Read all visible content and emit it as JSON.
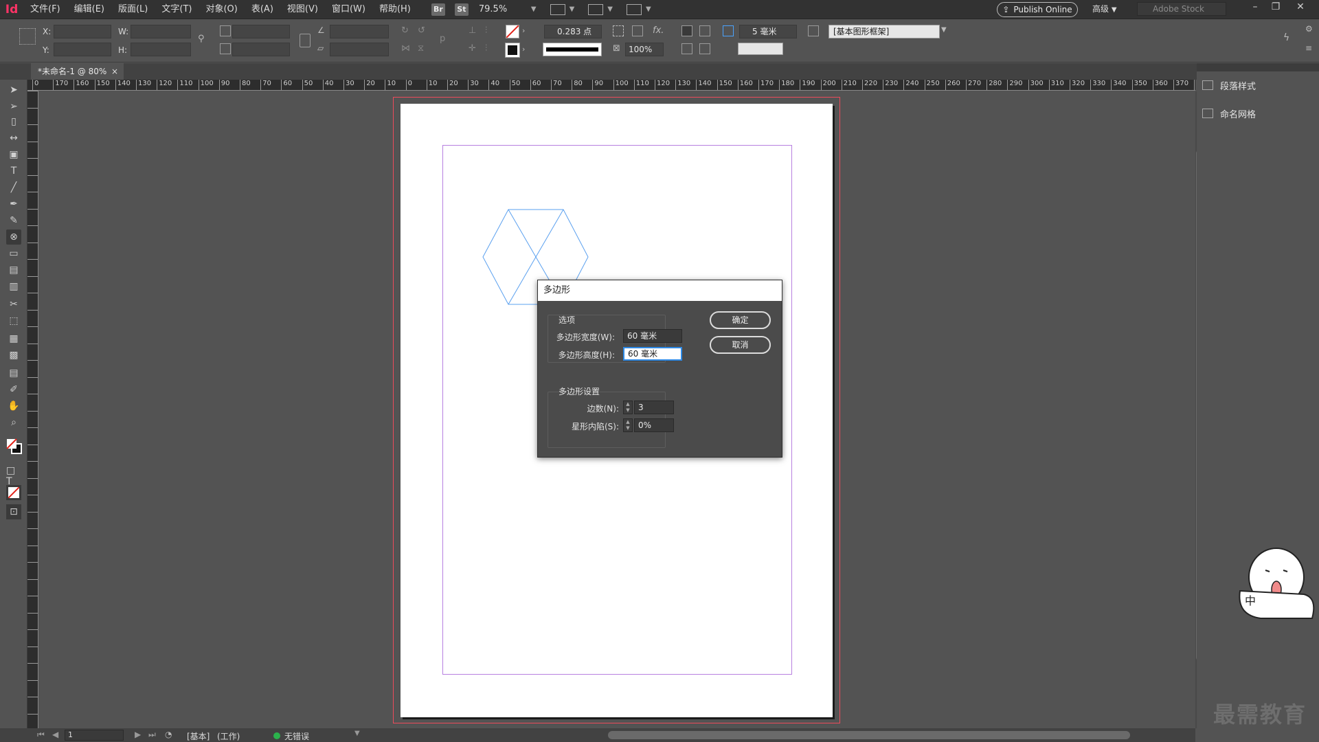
{
  "app": {
    "logo": "Id"
  },
  "menu": [
    "文件(F)",
    "编辑(E)",
    "版面(L)",
    "文字(T)",
    "对象(O)",
    "表(A)",
    "视图(V)",
    "窗口(W)",
    "帮助(H)"
  ],
  "menubar": {
    "bridge_badge": "Br",
    "stock_badge": "St",
    "zoom": "79.5%",
    "publish": "Publish Online",
    "workspace": "高级",
    "search_placeholder": "Adobe Stock"
  },
  "control": {
    "x_label": "X:",
    "y_label": "Y:",
    "w_label": "W:",
    "h_label": "H:",
    "stroke_weight": "0.283 点",
    "opacity": "100%",
    "corner": "5 毫米",
    "object_style": "[基本图形框架]"
  },
  "tab": {
    "title": "*未命名-1 @ 80%",
    "close": "×"
  },
  "ruler": {
    "h_labels": [
      "0",
      "170",
      "160",
      "150",
      "140",
      "130",
      "120",
      "110",
      "100",
      "90",
      "80",
      "70",
      "60",
      "50",
      "40",
      "30",
      "20",
      "10",
      "0",
      "10",
      "20",
      "30",
      "40",
      "50",
      "60",
      "70",
      "80",
      "90",
      "100",
      "110",
      "120",
      "130",
      "140",
      "150",
      "160",
      "170",
      "180",
      "190",
      "200",
      "210",
      "220",
      "230",
      "240",
      "250",
      "260",
      "270",
      "280",
      "290",
      "300",
      "310",
      "320",
      "330",
      "340",
      "350",
      "360",
      "370",
      "38"
    ]
  },
  "dialog": {
    "title": "多边形",
    "options_group": "选项",
    "width_label": "多边形宽度(W):",
    "width_value": "60 毫米",
    "height_label": "多边形高度(H):",
    "height_value": "60 毫米",
    "settings_group": "多边形设置",
    "sides_label": "边数(N):",
    "sides_value": "3",
    "inset_label": "星形内陷(S):",
    "inset_value": "0%",
    "ok": "确定",
    "cancel": "取消"
  },
  "panels": [
    {
      "icon": "paragraph-styles-icon",
      "label": "段落样式"
    },
    {
      "icon": "named-grid-icon",
      "label": "命名网格"
    }
  ],
  "status": {
    "page": "1",
    "master": "[基本]",
    "mode": "(工作)",
    "preflight": "无错误",
    "preflight_color": "#2bb24c"
  },
  "watermark": "最需教育",
  "mascot_text": "中",
  "colors": {
    "accent_red": "#ff3366",
    "margin": "#b77fe0",
    "bleed": "#ee4b5b",
    "shape": "#5aa0ef",
    "focus": "#2e8ae6"
  }
}
